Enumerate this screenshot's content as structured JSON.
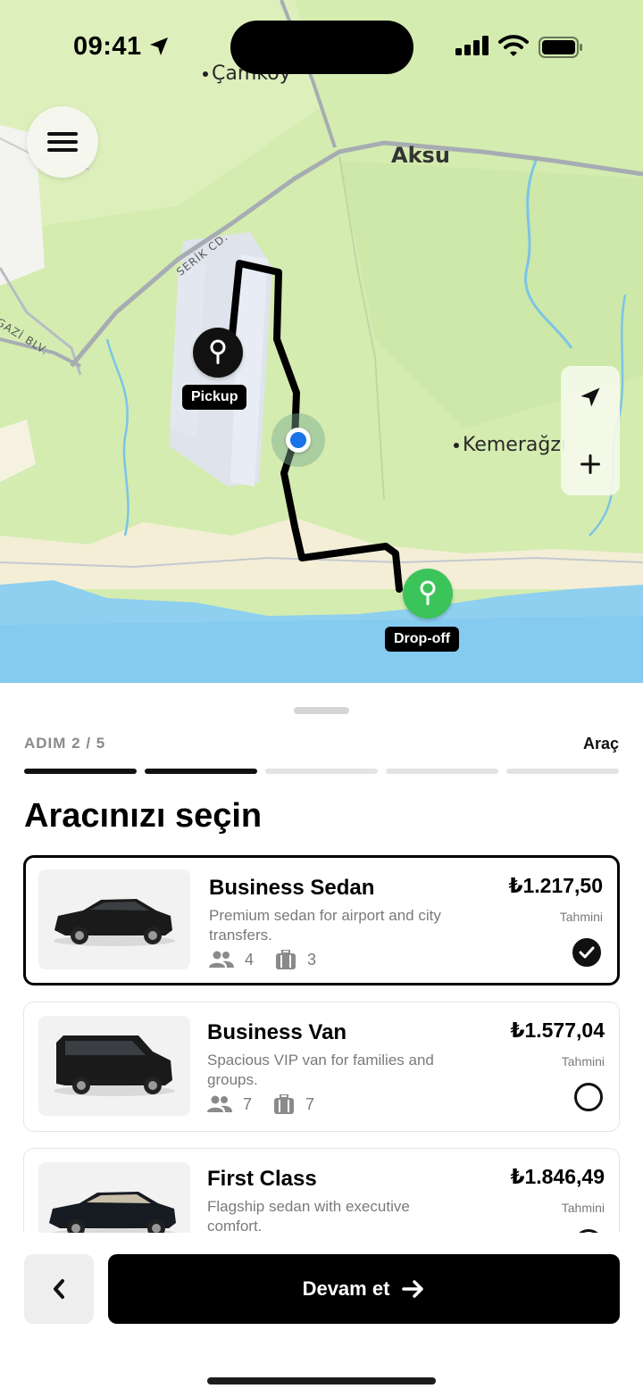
{
  "status_bar": {
    "time": "09:41"
  },
  "map": {
    "labels": {
      "camkoy": "Çamköy",
      "aksu": "Aksu",
      "kemeragzi": "Kemerağzı",
      "serik": "SERİK CD.",
      "gazi": "GAZİ BLV."
    },
    "pickup_label": "Pickup",
    "dropoff_label": "Drop-off",
    "colors": {
      "land": "#d4ecb0",
      "water": "#8fd0f0",
      "route": "#000000",
      "pickup_pin": "#111111",
      "dropoff_pin": "#3bc45a",
      "user_dot": "#1a73e8"
    }
  },
  "sheet": {
    "step_label": "ADIM 2 / 5",
    "step_name": "Araç",
    "steps_total": 5,
    "steps_done": 2,
    "title": "Aracınızı seçin",
    "vehicles": [
      {
        "name": "Business Sedan",
        "desc": "Premium sedan for airport and city transfers.",
        "passengers": "4",
        "luggage": "3",
        "price": "₺1.217,50",
        "estimate": "Tahmini",
        "selected": true
      },
      {
        "name": "Business Van",
        "desc": "Spacious VIP van for families and groups.",
        "passengers": "7",
        "luggage": "7",
        "price": "₺1.577,04",
        "estimate": "Tahmini",
        "selected": false
      },
      {
        "name": "First Class",
        "desc": "Flagship sedan with executive comfort.",
        "price": "₺1.846,49",
        "estimate": "Tahmini",
        "selected": false
      }
    ],
    "continue_label": "Devam et"
  }
}
